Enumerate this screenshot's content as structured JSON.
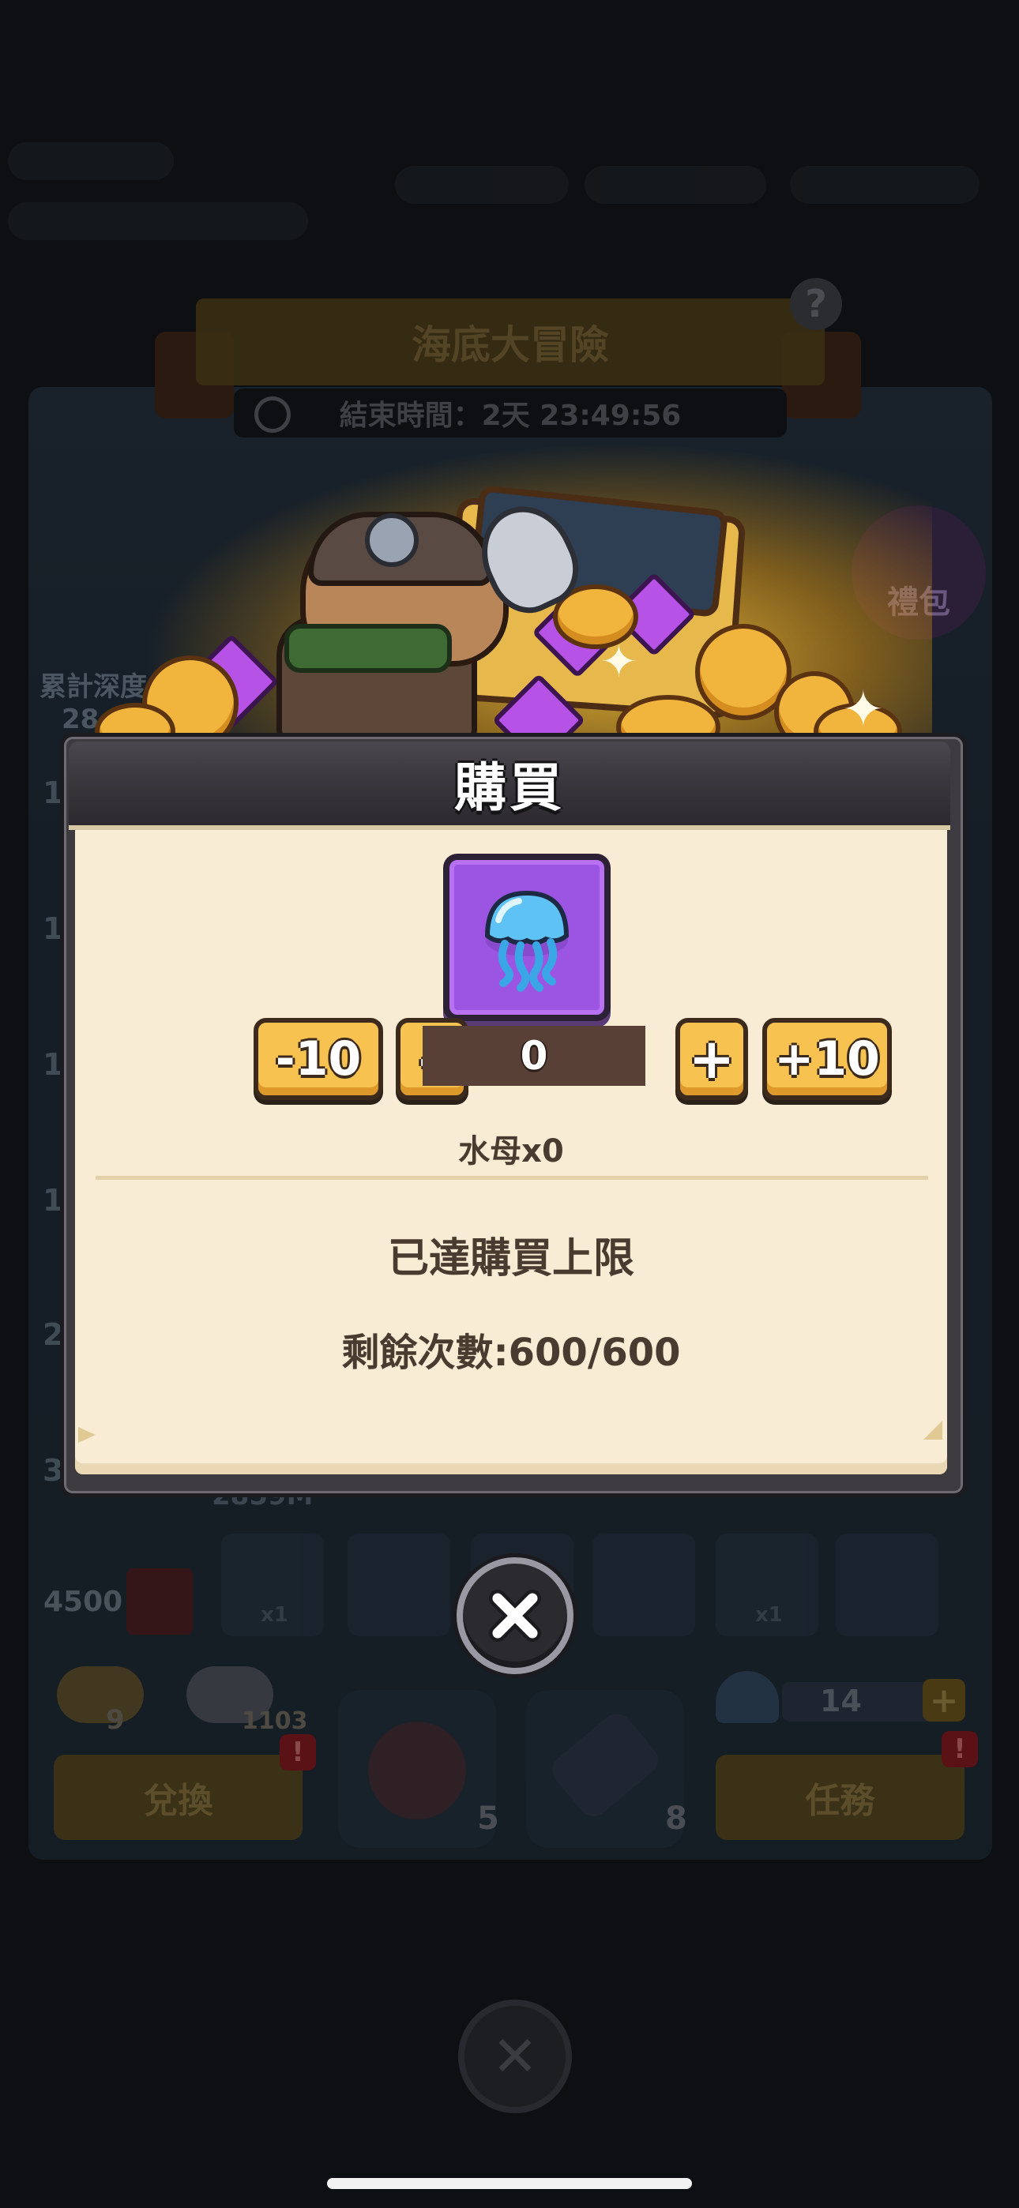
{
  "background": {
    "event_title": "海底大冒險",
    "timer_text": "結束時間：2天 23:49:56",
    "help_symbol": "?",
    "gift_label": "禮包",
    "depth_label": "累計深度",
    "depth_value": "28",
    "side_marks": [
      "1",
      "1",
      "1",
      "1",
      "2",
      "3"
    ],
    "milestone_depth": "2859M",
    "milestone_points": "4500",
    "slot_multipliers": [
      "x1",
      "x1"
    ],
    "shell_gold_count": "9",
    "shell_silver_count": "1103",
    "bomb_count": "5",
    "flashlight_count": "8",
    "jellyfish_count": "14",
    "exchange_button": "兌換",
    "quest_button": "任務",
    "badge_symbol": "!",
    "plus_symbol": "+"
  },
  "dialog": {
    "title": "購買",
    "item_icon": "jellyfish-icon",
    "minus_ten_label": "-10",
    "minus_one_label": "–",
    "quantity": "0",
    "plus_one_label": "+",
    "plus_ten_label": "+10",
    "item_name": "水母x0",
    "limit_message": "已達購買上限",
    "remaining": "剩餘次數:600/600"
  },
  "close_icon": "close-icon",
  "colors": {
    "button_yellow": "#f7c24f",
    "item_frame_purple": "#9b55e2",
    "panel_cream": "#f8ecd4",
    "header_dark": "#3d3a40"
  }
}
